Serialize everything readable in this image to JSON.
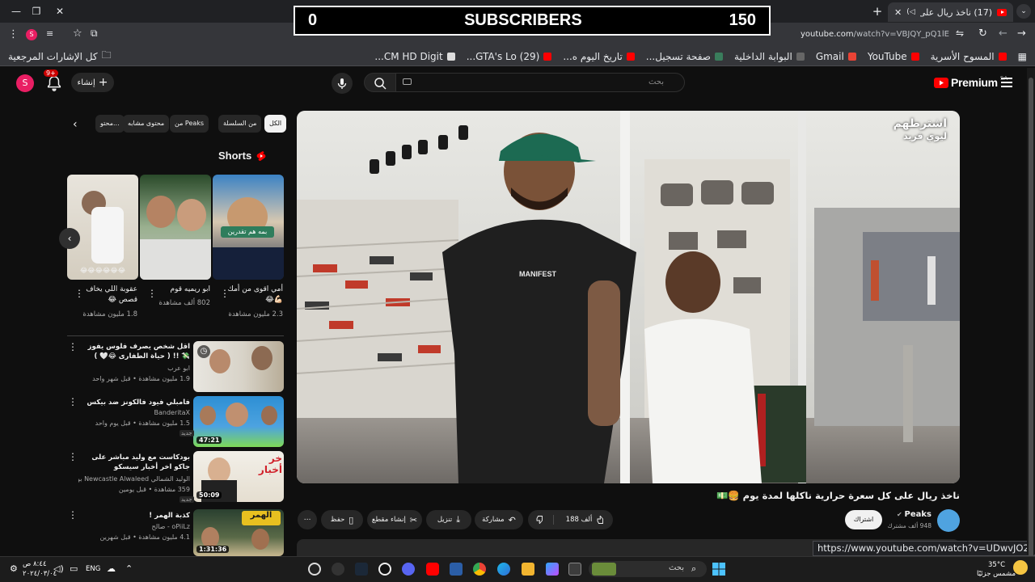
{
  "browser": {
    "tab_title": "(17) ناخذ ريال على",
    "url_host": "youtube.com",
    "url_path": "/watch?v=VBJQY_pQ1lE",
    "bookmarks": [
      "المسوح الأسرية",
      "YouTube",
      "Gmail",
      "البوابة الداخلية",
      "صفحة تسجيل...",
      "تاريخ اليوم ه...",
      "(29) GTA's Lo...",
      "CM HD Digit..."
    ],
    "all_bookmarks": "كل الإشارات المرجعية",
    "hover_url": "https://www.youtube.com/watch?v=UDwvJO2tUec"
  },
  "overlay": {
    "left_count": "0",
    "label": "SUBSCRIBERS",
    "right_count": "150"
  },
  "header": {
    "logo_text": "Premium",
    "region": "SA",
    "search_placeholder": "بحث",
    "create_label": "إنشاء",
    "notif_count": "9+",
    "avatar_letter": "S"
  },
  "chips": [
    "الكل",
    "من السلسلة",
    "من Peaks",
    "محتوى مشابه",
    "محتو..."
  ],
  "shorts": {
    "heading": "Shorts",
    "items": [
      {
        "title": "أمي اقوى من أمك 💪🏻😂",
        "views": "2.3 مليون مشاهدة",
        "overlay": "بمه هم تقدرين"
      },
      {
        "title": "ابو ريميه قوم",
        "views": "802 ألف مشاهدة",
        "overlay": ""
      },
      {
        "title": "عقوبة اللي يخاف قصص 😂",
        "views": "1.8 مليون مشاهدة",
        "overlay": "😂😂😂😂😂😂"
      }
    ]
  },
  "recommendations": [
    {
      "title": "اقل شخص يصرف فلوس يفوز 💸 !! ( حياة الطفارى 😂🤍 )",
      "channel": "ابو عرب",
      "meta": "1.9 مليون مشاهدة • قبل شهر واحد",
      "duration": "",
      "badge": ""
    },
    {
      "title": "فامبلي فيود فالكونز ضد بيكس",
      "channel": "BanderitaX",
      "meta": "1.5 مليون مشاهدة • قبل يوم واحد",
      "duration": "47:21",
      "badge": "جديد"
    },
    {
      "title": "بودكاست مع وليد مباشر على جاكو اخر أخبار سيسكو",
      "channel": "الوليد الشمالي Newcastle Alwaleed بودكاست مع و...",
      "meta": "359 مشاهدة • قبل يومين",
      "duration": "50:09",
      "badge": "جديد"
    },
    {
      "title": "كذبة الهمر !",
      "channel": "oPiiLz - صالح",
      "meta": "4.1 مليون مشاهدة • قبل شهرين",
      "duration": "1:31:36",
      "badge": ""
    }
  ],
  "video": {
    "title": "ناخذ ريال على كل سعرة حرارية ناكلها لمدة يوم 🍔💵",
    "watermark_line1": "اشترطهم",
    "watermark_line2": "ليوي فريد",
    "shirt_text": "MANIFEST",
    "channel_name": "Peaks",
    "channel_subs": "948 ألف مشترك",
    "subscribe_label": "اشتراك",
    "like_count": "188 ألف",
    "share_label": "مشاركة",
    "download_label": "تنزيل",
    "clip_label": "إنشاء مقطع",
    "save_label": "حفظ"
  },
  "taskbar": {
    "search_label": "بحث",
    "lang": "ENG",
    "time": "٨:٤٤ ص",
    "date": "٢٠٢٤/٠٣/٠٤",
    "weather_temp": "35°C",
    "weather_desc": "مشمس جزئيًا"
  },
  "colors": {
    "yt_red": "#ff0000",
    "bg": "#0f0f0f",
    "chip_bg": "#272727"
  }
}
